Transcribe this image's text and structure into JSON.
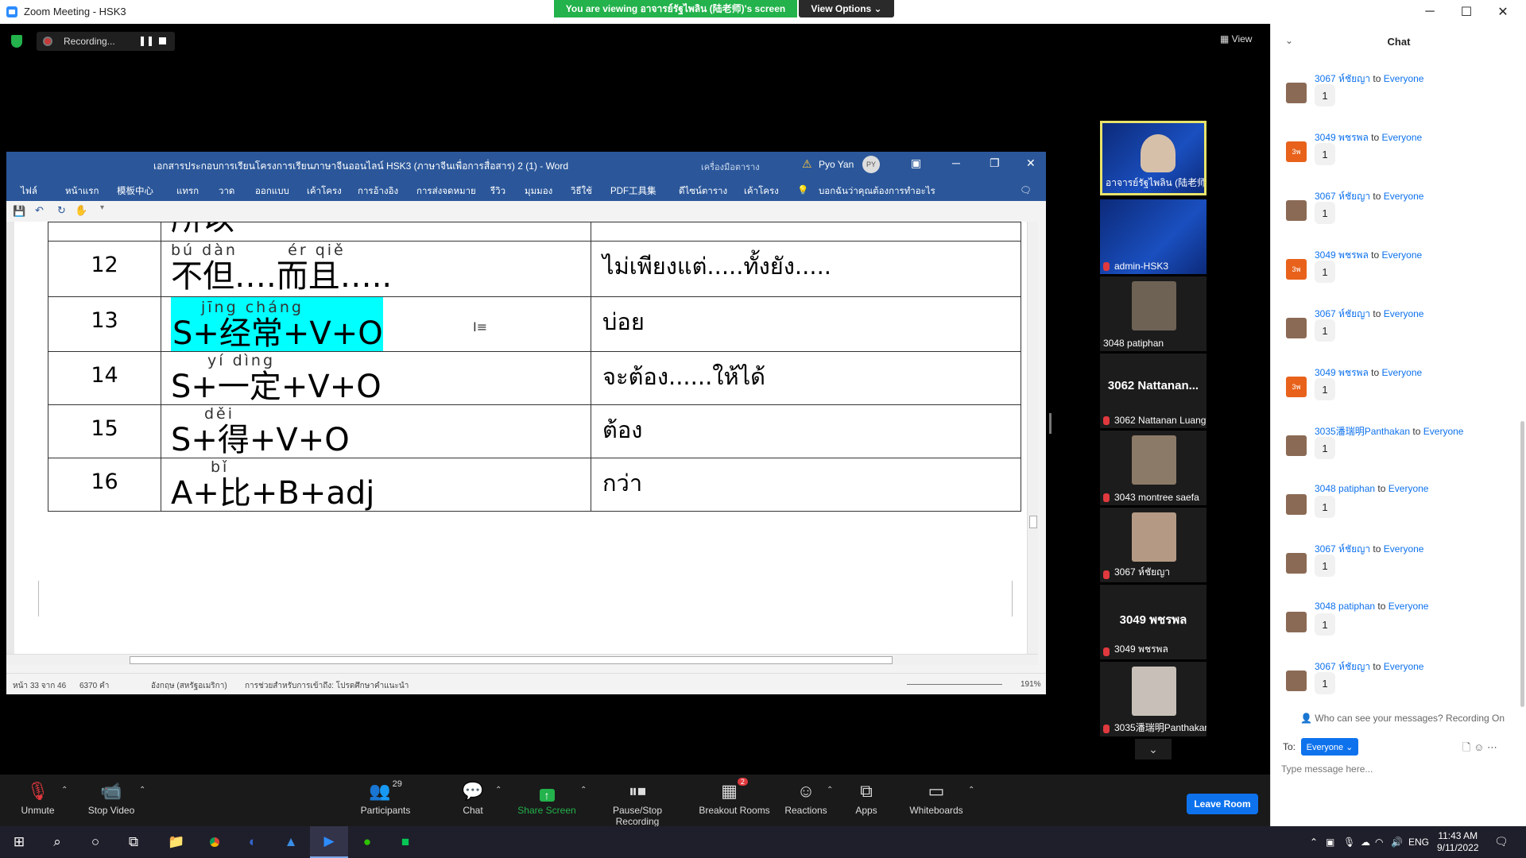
{
  "window": {
    "title": "Zoom Meeting - HSK3",
    "minimize": "─",
    "maximize": "☐",
    "close": "✕"
  },
  "banner": {
    "text": "You are viewing อาจารย์รัฐไพลิน (陆老师)'s screen",
    "view_options": "View Options ⌄"
  },
  "recording": {
    "label": "Recording...",
    "pause": "❚❚"
  },
  "view_button": "▦ View",
  "word": {
    "doc_title": "เอกสารประกอบการเรียนโครงการเรียนภาษาจีนออนไลน์ HSK3 (ภาษาจีนเพื่อการสื่อสาร) 2 (1)  -  Word",
    "table_tools": "เครื่องมือตาราง",
    "user": "Pyo Yan",
    "user_initials": "PY",
    "ribbon_tabs": [
      "ไฟล์",
      "หน้าแรก",
      "模板中心",
      "แทรก",
      "วาด",
      "ออกแบบ",
      "เค้าโครง",
      "การอ้างอิง",
      "การส่งจดหมาย",
      "รีวิว",
      "มุมมอง",
      "วิธีใช้",
      "PDF工具集",
      "ดีไซน์ตาราง",
      "เค้าโครง"
    ],
    "tell_me": "บอกฉันว่าคุณต้องการทำอะไร",
    "rows": [
      {
        "num": "12",
        "pinyin": "bú dàn       ér qiě",
        "formula": "不但….而且…..",
        "thai": "ไม่เพียงแต่.....ทั้งยัง....."
      },
      {
        "num": "13",
        "pinyin": "jīng cháng",
        "formula": "S+经常+V+O",
        "thai": "บ่อย"
      },
      {
        "num": "14",
        "pinyin": "yí dìng",
        "formula": "S+一定+V+O",
        "thai": "จะต้อง......ให้ได้"
      },
      {
        "num": "15",
        "pinyin": "děi",
        "formula": "S+得+V+O",
        "thai": "ต้อง"
      },
      {
        "num": "16",
        "pinyin": "bǐ",
        "formula": "A+比+B+adj",
        "thai": "กว่า"
      }
    ],
    "status": {
      "page": "หน้า 33 จาก 46",
      "words": "6370 คำ",
      "language": "อังกฤษ (สหรัฐอเมริกา)",
      "accessibility": "การช่วยสำหรับการเข้าถึง: โปรดศึกษาคำแนะนำ",
      "zoom": "191%"
    }
  },
  "thumbnails": [
    {
      "name": "อาจารย์รัฐไพลิน (陆老师)",
      "type": "video-slide",
      "active": true
    },
    {
      "name": "admin-HSK3",
      "type": "slide",
      "muted": true
    },
    {
      "name": "3048 patiphan",
      "type": "video"
    },
    {
      "name": "3062 Nattanan Luang...",
      "big": "3062  Nattanan...",
      "type": "name",
      "muted": true
    },
    {
      "name": "3043 montree saefa",
      "type": "video",
      "muted": true
    },
    {
      "name": "3067 ห์ชัยญา",
      "type": "video",
      "muted": true
    },
    {
      "name": "3049 พชรพล",
      "big": "3049  พชรพล",
      "type": "name",
      "muted": true
    },
    {
      "name": "3035潘瑞明Panthakan",
      "type": "video",
      "muted": true
    }
  ],
  "toolbar": {
    "unmute": "Unmute",
    "stop_video": "Stop Video",
    "participants": "Participants",
    "participants_count": "29",
    "chat": "Chat",
    "share_screen": "Share Screen",
    "pause_stop_recording": "Pause/Stop Recording",
    "breakout_rooms": "Breakout Rooms",
    "breakout_badge": "2",
    "reactions": "Reactions",
    "apps": "Apps",
    "whiteboards": "Whiteboards",
    "leave_room": "Leave Room"
  },
  "chat": {
    "title": "Chat",
    "messages": [
      {
        "from": "3067 ห์ชัยญา",
        "to": "Everyone",
        "text": "1",
        "avatar": "photo"
      },
      {
        "from": "3049 พชรพล",
        "to": "Everyone",
        "text": "1",
        "avatar": "3พ"
      },
      {
        "from": "3067 ห์ชัยญา",
        "to": "Everyone",
        "text": "1",
        "avatar": "photo"
      },
      {
        "from": "3049 พชรพล",
        "to": "Everyone",
        "text": "1",
        "avatar": "3พ"
      },
      {
        "from": "3067 ห์ชัยญา",
        "to": "Everyone",
        "text": "1",
        "avatar": "photo"
      },
      {
        "from": "3049 พชรพล",
        "to": "Everyone",
        "text": "1",
        "avatar": "3พ"
      },
      {
        "from": "3035潘瑞明Panthakan",
        "to": "Everyone",
        "text": "1",
        "avatar": "photo"
      },
      {
        "from": "3048 patiphan",
        "to": "Everyone",
        "text": "1",
        "avatar": "photo"
      },
      {
        "from": "3067 ห์ชัยญา",
        "to": "Everyone",
        "text": "1",
        "avatar": "photo"
      },
      {
        "from": "3048 patiphan",
        "to": "Everyone",
        "text": "1",
        "avatar": "photo"
      },
      {
        "from": "3067 ห์ชัยญา",
        "to": "Everyone",
        "text": "1",
        "avatar": "photo"
      }
    ],
    "to_word": "to",
    "who_can_see": "Who can see your messages? Recording On",
    "to_label": "To:",
    "to_value": "Everyone ⌄",
    "placeholder": "Type message here..."
  },
  "taskbar": {
    "lang": "ENG",
    "time": "11:43 AM",
    "date": "9/11/2022"
  }
}
